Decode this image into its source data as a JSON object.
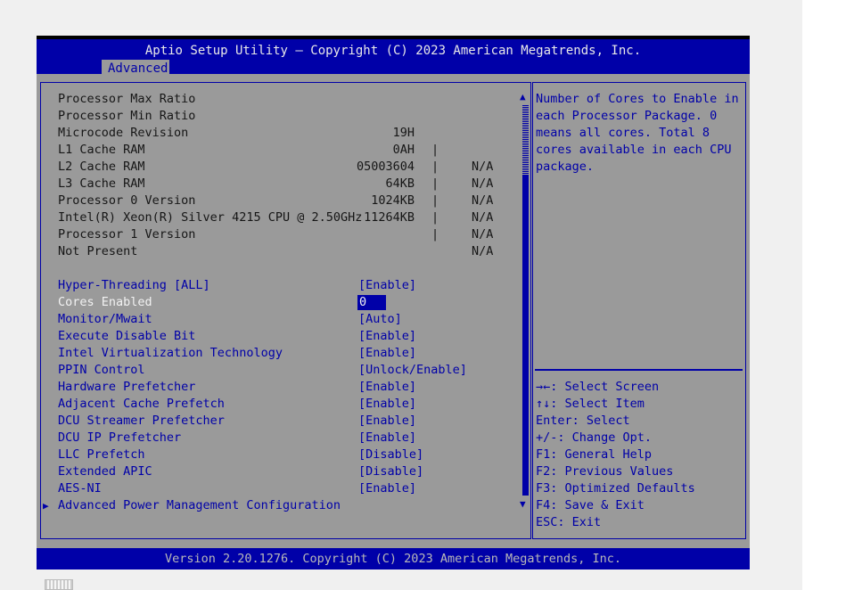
{
  "header": {
    "title": "Aptio Setup Utility – Copyright (C) 2023 American Megatrends, Inc.",
    "active_tab": "Advanced"
  },
  "info_rows": [
    {
      "label": "Processor Max Ratio",
      "value": "19H",
      "sep": "|",
      "na": "N/A"
    },
    {
      "label": "Processor Min Ratio",
      "value": "0AH",
      "sep": "|",
      "na": "N/A"
    },
    {
      "label": "Microcode Revision",
      "value": "05003604",
      "sep": "|",
      "na": "N/A"
    },
    {
      "label": "L1 Cache RAM",
      "value": "64KB",
      "sep": "|",
      "na": "N/A"
    },
    {
      "label": "L2 Cache RAM",
      "value": "1024KB",
      "sep": "|",
      "na": "N/A"
    },
    {
      "label": "L3 Cache RAM",
      "value": "11264KB",
      "sep": "|",
      "na": "N/A"
    }
  ],
  "processor_info": [
    "Processor 0 Version",
    "Intel(R) Xeon(R) Silver 4215 CPU @ 2.50GHz",
    "Processor 1 Version",
    "Not Present"
  ],
  "options": [
    {
      "label": "Hyper-Threading [ALL]",
      "value": "[Enable]"
    },
    {
      "label": "Cores Enabled",
      "value": "0"
    },
    {
      "label": "Monitor/Mwait",
      "value": "[Auto]"
    },
    {
      "label": "Execute Disable Bit",
      "value": "[Enable]"
    },
    {
      "label": "Intel Virtualization Technology",
      "value": "[Enable]"
    },
    {
      "label": "PPIN Control",
      "value": "[Unlock/Enable]"
    },
    {
      "label": "Hardware Prefetcher",
      "value": "[Enable]"
    },
    {
      "label": "Adjacent Cache Prefetch",
      "value": "[Enable]"
    },
    {
      "label": "DCU Streamer Prefetcher",
      "value": "[Enable]"
    },
    {
      "label": "DCU IP Prefetcher",
      "value": "[Enable]"
    },
    {
      "label": "LLC Prefetch",
      "value": "[Disable]"
    },
    {
      "label": "Extended APIC",
      "value": "[Disable]"
    },
    {
      "label": "AES-NI",
      "value": "[Enable]"
    },
    {
      "label": "Advanced Power Management Configuration",
      "submenu_arrow": "▶"
    }
  ],
  "help": {
    "description": "Number of Cores to Enable in each Processor Package. 0 means all cores. Total 8 cores available in each CPU package.",
    "keys": [
      "→←: Select Screen",
      "↑↓: Select Item",
      "Enter: Select",
      "+/-: Change Opt.",
      "F1: General Help",
      "F2: Previous Values",
      "F3: Optimized Defaults",
      "F4: Save & Exit",
      "ESC: Exit"
    ]
  },
  "scrollbar": {
    "up_arrow": "▲",
    "down_arrow": "▼"
  },
  "footer": {
    "text": "Version 2.20.1276. Copyright (C) 2023 American Megatrends, Inc."
  }
}
